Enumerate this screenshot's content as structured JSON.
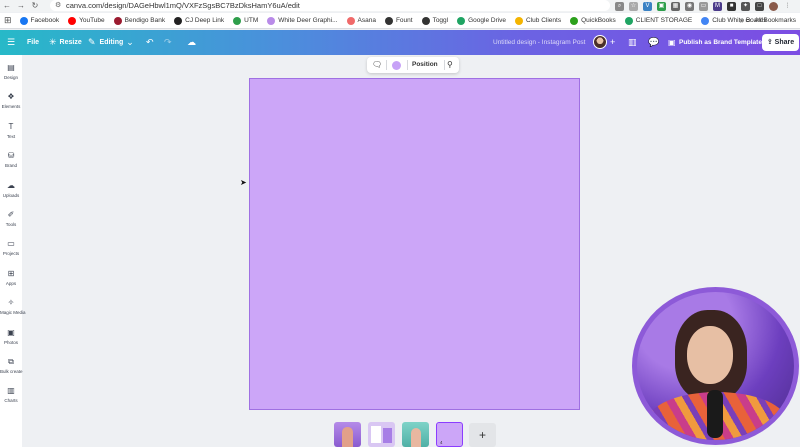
{
  "browser": {
    "url": "canva.com/design/DAGeHbwl1mQ/VXFzSgsBC7BzDksHamY6uA/edit",
    "bookmarks": [
      {
        "label": "Facebook",
        "color": "#1877f2"
      },
      {
        "label": "YouTube",
        "color": "#ff0000"
      },
      {
        "label": "Bendigo Bank",
        "color": "#9b1b30"
      },
      {
        "label": "CJ Deep Link",
        "color": "#222222"
      },
      {
        "label": "UTM",
        "color": "#2e9e4b"
      },
      {
        "label": "White Deer Graphi...",
        "color": "#b98be8"
      },
      {
        "label": "Asana",
        "color": "#f06a6a"
      },
      {
        "label": "Fount",
        "color": "#333333"
      },
      {
        "label": "Toggl",
        "color": "#333333"
      },
      {
        "label": "Google Drive",
        "color": "#1fa463"
      },
      {
        "label": "Club Clients",
        "color": "#f4b400"
      },
      {
        "label": "QuickBooks",
        "color": "#2ca01c"
      },
      {
        "label": "CLIENT STORAGE",
        "color": "#1fa463"
      },
      {
        "label": "Club White Boards",
        "color": "#4285f4"
      }
    ],
    "all_bookmarks": "All Bookmarks"
  },
  "toolbar": {
    "file": "File",
    "resize": "Resize",
    "editing": "Editing",
    "design_title": "Untitled design - Instagram Post",
    "publish": "Publish as Brand Template",
    "share": "Share"
  },
  "sidebar": {
    "items": [
      {
        "label": "Design",
        "icon": "design-icon"
      },
      {
        "label": "Elements",
        "icon": "elements-icon"
      },
      {
        "label": "Text",
        "icon": "text-icon"
      },
      {
        "label": "Brand",
        "icon": "brand-icon"
      },
      {
        "label": "Uploads",
        "icon": "uploads-icon"
      },
      {
        "label": "Tools",
        "icon": "tools-icon"
      },
      {
        "label": "Projects",
        "icon": "projects-icon"
      },
      {
        "label": "Apps",
        "icon": "apps-icon"
      },
      {
        "label": "Magic Media",
        "icon": "magic-media-icon"
      },
      {
        "label": "Photos",
        "icon": "photos-icon"
      },
      {
        "label": "Bulk create",
        "icon": "bulk-create-icon"
      },
      {
        "label": "Charts",
        "icon": "charts-icon"
      }
    ]
  },
  "context_toolbar": {
    "position_label": "Position",
    "swatch_color": "#c7a2f7"
  },
  "canvas": {
    "background_color": "#cca6f8"
  },
  "pages": {
    "current_page_number": "4",
    "add_label": "+"
  }
}
